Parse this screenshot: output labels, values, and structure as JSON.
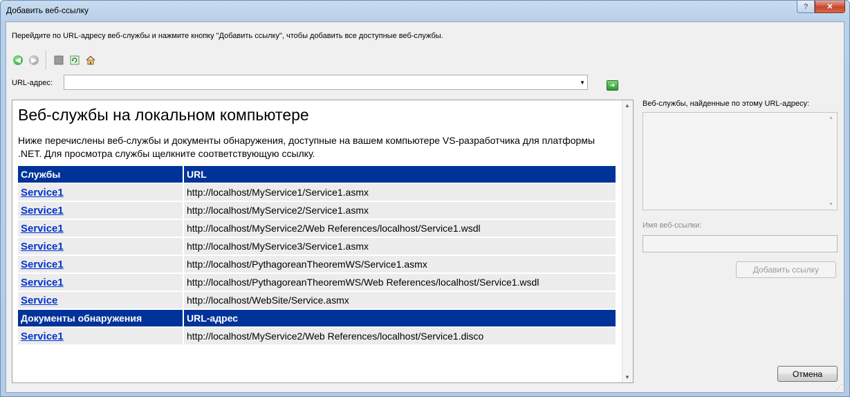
{
  "window": {
    "title": "Добавить веб-ссылку",
    "help_label": "?",
    "close_label": "✕"
  },
  "instruction": "Перейдите по URL-адресу веб-службы и нажмите кнопку \"Добавить ссылку\", чтобы добавить все доступные веб-службы.",
  "toolbar": {
    "buttons": [
      {
        "icon": "back-arrow-icon",
        "color": "#2a9a2a"
      },
      {
        "icon": "forward-arrow-icon",
        "color": "#9a9a9a"
      },
      {
        "icon": "stop-icon",
        "color": "#8a8a8a"
      },
      {
        "icon": "refresh-icon",
        "color": "#2a9a2a"
      },
      {
        "icon": "home-icon",
        "color": "#c98a2a"
      }
    ]
  },
  "url": {
    "label": "URL-адрес:",
    "value": "",
    "go_icon": "go-arrow-icon"
  },
  "browser": {
    "heading": "Веб-службы на локальном компьютере",
    "description": "Ниже перечислены веб-службы и документы обнаружения, доступные на вашем компьютере VS-разработчика для платформы .NET. Для просмотра службы щелкните соответствующую ссылку.",
    "services_header": [
      "Службы",
      "URL"
    ],
    "services": [
      {
        "name": "Service1",
        "url": "http://localhost/MyService1/Service1.asmx"
      },
      {
        "name": "Service1",
        "url": "http://localhost/MyService2/Service1.asmx"
      },
      {
        "name": "Service1",
        "url": "http://localhost/MyService2/Web References/localhost/Service1.wsdl"
      },
      {
        "name": "Service1",
        "url": "http://localhost/MyService3/Service1.asmx"
      },
      {
        "name": "Service1",
        "url": "http://localhost/PythagoreanTheoremWS/Service1.asmx"
      },
      {
        "name": "Service1",
        "url": "http://localhost/PythagoreanTheoremWS/Web References/localhost/Service1.wsdl"
      },
      {
        "name": "Service",
        "url": "http://localhost/WebSite/Service.asmx"
      }
    ],
    "discovery_header": [
      "Документы обнаружения",
      "URL-адрес"
    ],
    "discovery": [
      {
        "name": "Service1",
        "url": "http://localhost/MyService2/Web References/localhost/Service1.disco"
      }
    ]
  },
  "right_panel": {
    "found_label": "Веб-службы, найденные по этому URL-адресу:",
    "name_label": "Имя веб-ссылки:",
    "name_value": "",
    "add_button": "Добавить ссылку"
  },
  "cancel_button": "Отмена",
  "colors": {
    "table_header": "#003399",
    "link": "#0033cc"
  }
}
